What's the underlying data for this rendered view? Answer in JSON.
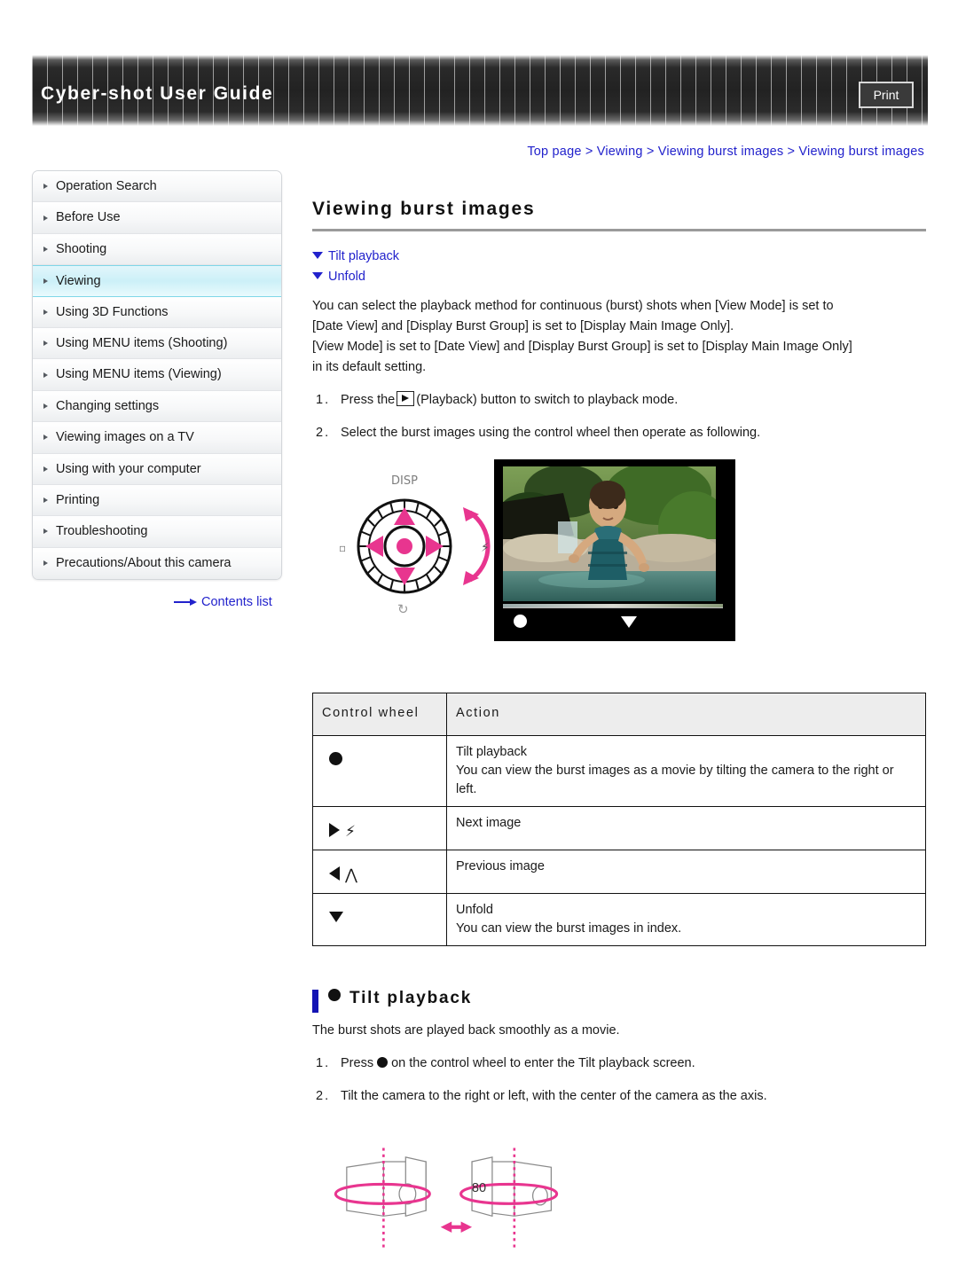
{
  "header": {
    "title": "Cyber-shot User Guide",
    "print_label": "Print"
  },
  "breadcrumb": {
    "text": "Top page > Viewing > Viewing burst images > Viewing burst images"
  },
  "sidebar": {
    "items": [
      {
        "label": "Operation Search",
        "active": false
      },
      {
        "label": "Before Use",
        "active": false
      },
      {
        "label": "Shooting",
        "active": false
      },
      {
        "label": "Viewing",
        "active": true
      },
      {
        "label": "Using 3D Functions",
        "active": false
      },
      {
        "label": "Using MENU items (Shooting)",
        "active": false
      },
      {
        "label": "Using MENU items (Viewing)",
        "active": false
      },
      {
        "label": "Changing settings",
        "active": false
      },
      {
        "label": "Viewing images on a TV",
        "active": false
      },
      {
        "label": "Using with your computer",
        "active": false
      },
      {
        "label": "Printing",
        "active": false
      },
      {
        "label": "Troubleshooting",
        "active": false
      },
      {
        "label": "Precautions/About this camera",
        "active": false
      }
    ],
    "contents_link": "Contents list"
  },
  "main": {
    "page_title": "Viewing burst images",
    "jump_links": [
      {
        "label": "Tilt playback"
      },
      {
        "label": "Unfold"
      }
    ],
    "intro_line1": "You can select the playback method for continuous (burst) shots when [View Mode] is set to",
    "intro_line2": "[Date View] and [Display Burst Group] is set to [Display Main Image Only].",
    "intro_line3": "[View Mode] is set to [Date View] and [Display Burst Group] is set to [Display Main Image Only]",
    "intro_line4": "in its default setting.",
    "step1_num": "1.",
    "step1_before": "Press the",
    "step1_after": "(Playback) button to switch to playback mode.",
    "step2_num": "2.",
    "step2_text": "Select the burst images using the control wheel then operate as following.",
    "wheel_disp_label": "DISP"
  },
  "table": {
    "headers": [
      "Control wheel",
      "Action"
    ],
    "rows": [
      {
        "symbol": "filled-circle",
        "action_title": "Tilt playback",
        "action_line1": "You can view the burst images as a movie by tilting the camera to the right or",
        "action_line2": "left."
      },
      {
        "symbol": "right-arrow-flash",
        "action_title": "Next image",
        "action_line1": "",
        "action_line2": ""
      },
      {
        "symbol": "left-arrow-up",
        "action_title": "Previous image",
        "action_line1": "",
        "action_line2": ""
      },
      {
        "symbol": "down-triangle",
        "action_title": "Unfold",
        "action_line1": "You can view the burst images in index.",
        "action_line2": ""
      }
    ]
  },
  "tilt_section": {
    "heading": "Tilt playback",
    "intro": "The burst shots are played back smoothly as a movie.",
    "step1_num": "1.",
    "step1_before": "Press",
    "step1_after": "on the control wheel to enter the Tilt playback screen.",
    "step2_num": "2.",
    "step2_text": "Tilt the camera to the right or left, with the center of the camera as the axis."
  },
  "footer": {
    "page_number": "80"
  },
  "colors": {
    "link": "#2222cc",
    "accent_pink": "#e8358f",
    "highlight": "#ccf0f8",
    "heading_bar": "#1414b4"
  }
}
